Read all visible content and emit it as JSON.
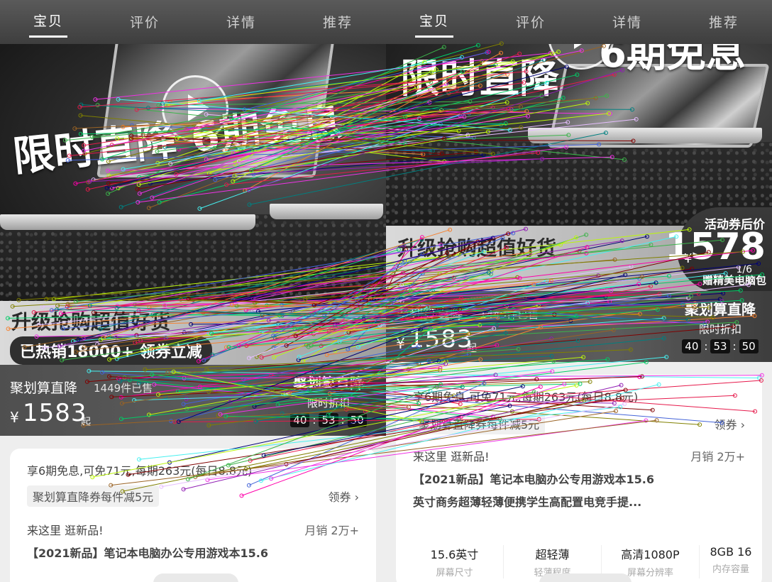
{
  "tabs": [
    "宝贝",
    "评价",
    "详情",
    "推荐"
  ],
  "active_tab": 0,
  "banner": {
    "left_text": "限时直降 6期免息",
    "right_text_1": "限时直降",
    "right_text_2": "6期免息"
  },
  "left": {
    "upgrade_title": "升级抢购超值好货",
    "hot_pill": "已热销18000+ 领券立减",
    "price_bar": {
      "label": "聚划算直降",
      "sold": "1449件已售",
      "yen": "¥",
      "price": "1583",
      "suffix": "起",
      "right_big": "聚划算直降",
      "right_small": "限时折扣",
      "timer": [
        "40",
        "53",
        "50"
      ]
    },
    "card": {
      "installment": "享6期免息,可免71元,每期263元(每日8.8元)",
      "coupon": "聚划算直降券每件减5元",
      "get_coupon": "领券",
      "store_line": "来这里 逛新品!",
      "sales": "月销 2万+",
      "title": "【2021新品】笔记本电脑办公专用游戏本15.6"
    }
  },
  "right": {
    "promo": {
      "label": "活动券后价",
      "yen": "¥",
      "price": "1578",
      "gift": "赠精美电脑包",
      "counter": "1/6"
    },
    "upgrade_title": "升级抢购超值好货",
    "price_bar": {
      "label": "聚划算直降",
      "sold": "1449件已售",
      "yen": "¥",
      "price": "1583",
      "suffix": "起",
      "right_big": "聚划算直降",
      "right_small": "限时折扣",
      "timer": [
        "40",
        "53",
        "50"
      ]
    },
    "card": {
      "installment": "享6期免息,可免71元,每期263元(每日8.8元)",
      "coupon": "聚划算直降券每件减5元",
      "get_coupon": "领券",
      "store_line": "来这里 逛新品!",
      "sales": "月销 2万+",
      "title_line1": "【2021新品】笔记本电脑办公专用游戏本15.6",
      "title_line2": "英寸商务超薄轻薄便携学生高配置电竞手提...",
      "specs": [
        {
          "value": "15.6英寸",
          "key": "屏幕尺寸"
        },
        {
          "value": "超轻薄",
          "key": "轻薄程度"
        },
        {
          "value": "高清1080P",
          "key": "屏幕分辨率"
        },
        {
          "value": "8GB 16",
          "key": "内存容量"
        }
      ]
    }
  },
  "colors": {
    "dark_bar": "#4f4f4f",
    "tab_bg": "#4a4a4a",
    "card_bg": "#ffffff"
  }
}
